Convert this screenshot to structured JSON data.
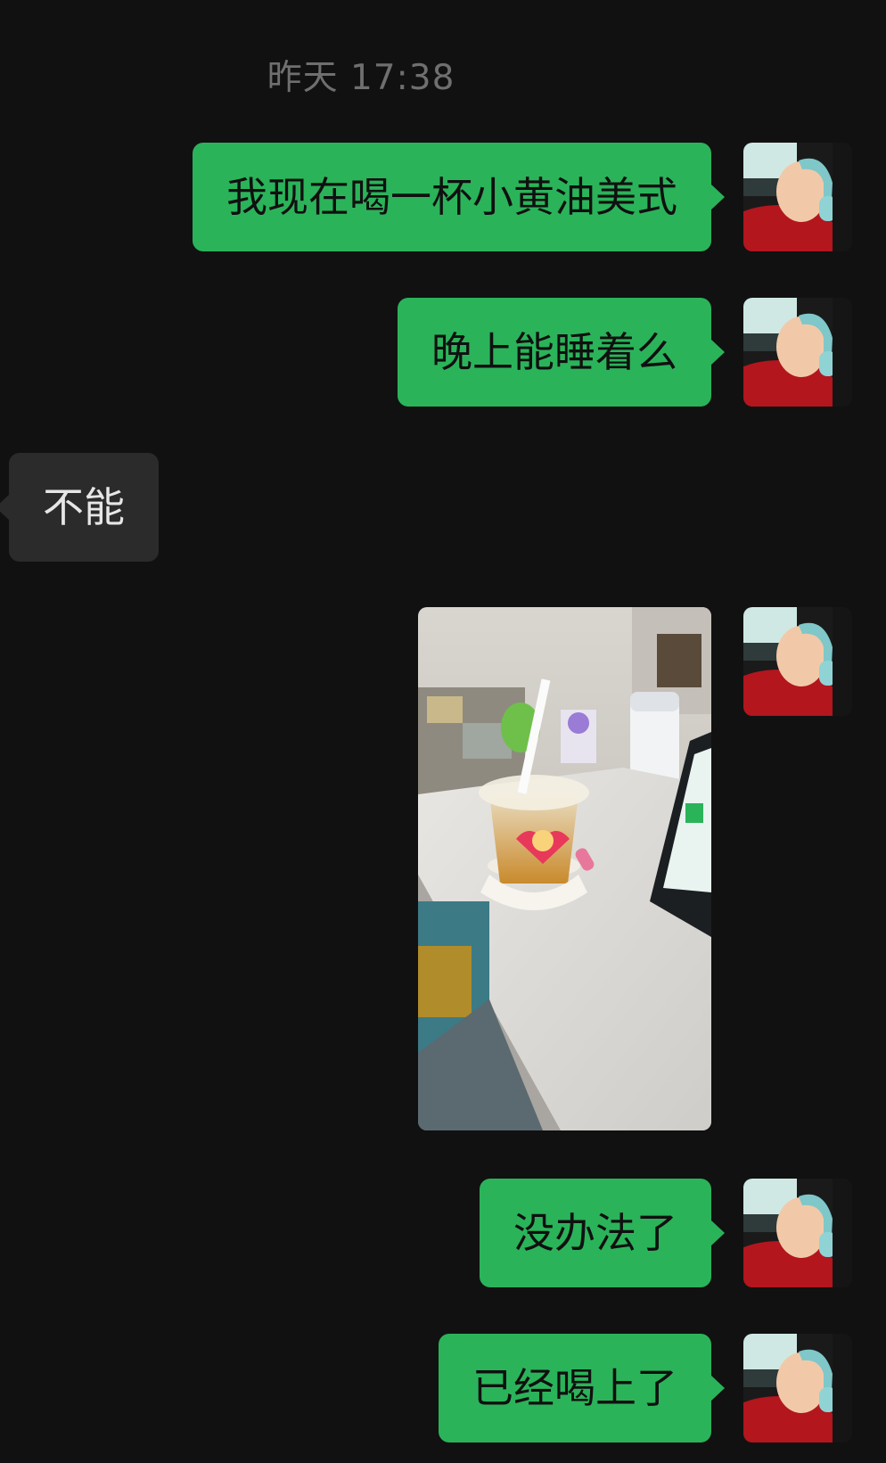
{
  "chat": {
    "timestamp": "昨天 17:38",
    "messages": [
      {
        "side": "out",
        "text": "我现在喝一杯小黄油美式"
      },
      {
        "side": "out",
        "text": "晚上能睡着么"
      },
      {
        "side": "in",
        "text": "不能"
      },
      {
        "side": "out",
        "type": "image",
        "image_desc": "photo-iced-coffee-cup-on-desk"
      },
      {
        "side": "out",
        "text": "没办法了"
      },
      {
        "side": "out",
        "text": "已经喝上了"
      }
    ]
  },
  "colors": {
    "background": "#111111",
    "outgoing_bubble": "#2bb35a",
    "incoming_bubble": "#2b2b2b",
    "timestamp_text": "#6f6f6f"
  }
}
